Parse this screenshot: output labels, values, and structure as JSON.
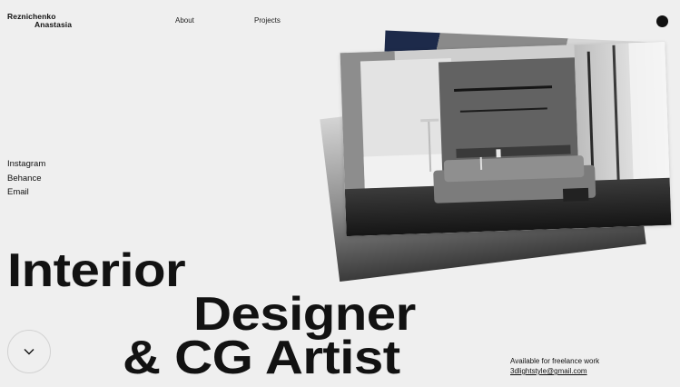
{
  "header": {
    "logo": {
      "line1": "Reznichenko",
      "line2": "Anastasia"
    },
    "nav": [
      {
        "label": "About"
      },
      {
        "label": "Projects"
      }
    ]
  },
  "social": [
    {
      "label": "Instagram"
    },
    {
      "label": "Behance"
    },
    {
      "label": "Email"
    }
  ],
  "hero": {
    "line1": "Interior",
    "line2": "Designer",
    "line3": "& CG Artist"
  },
  "contact": {
    "availability": "Available for freelance work",
    "email": "3dlightstyle@gmail.com"
  },
  "colors": {
    "background": "#efefef",
    "text": "#111111",
    "accent": "#111111"
  },
  "icons": {
    "scroll": "chevron-down-icon",
    "menu": "dot-menu-icon"
  }
}
